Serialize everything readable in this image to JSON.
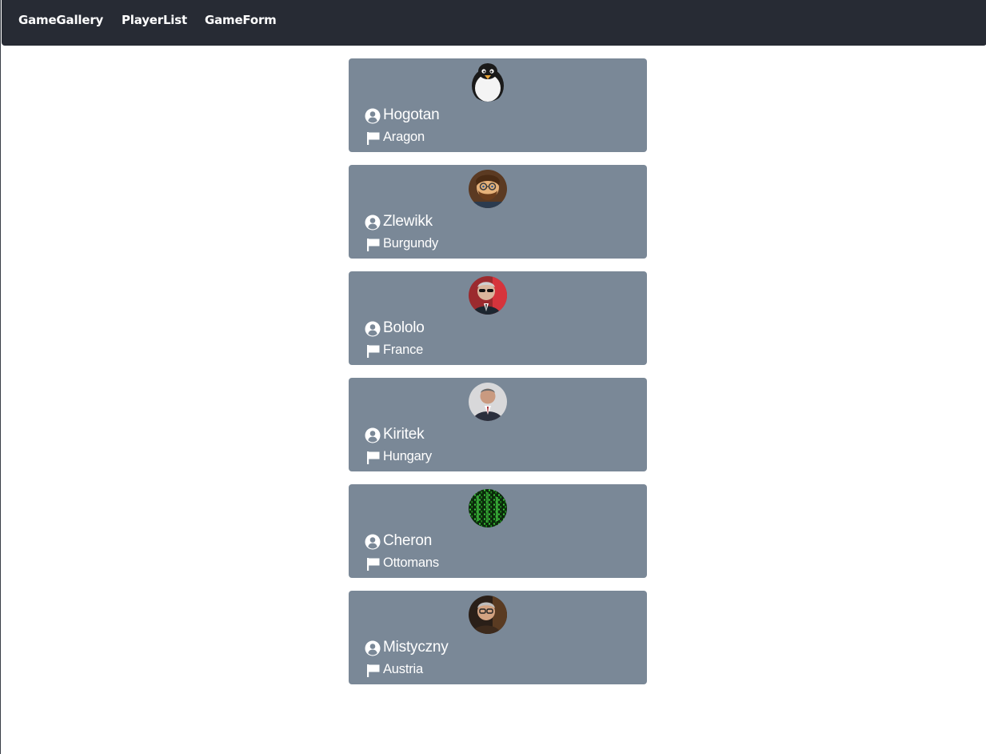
{
  "navbar": {
    "links": [
      {
        "label": "GameGallery"
      },
      {
        "label": "PlayerList"
      },
      {
        "label": "GameForm"
      }
    ],
    "background": "#272b34"
  },
  "theme": {
    "card_background": "#7a8897",
    "text_color": "#ffffff"
  },
  "players": [
    {
      "name": "Hogotan",
      "country": "Aragon",
      "avatar": "penguin-avatar",
      "user_icon": "user-circle-icon",
      "country_icon": "flag-icon"
    },
    {
      "name": "Zlewikk",
      "country": "Burgundy",
      "avatar": "bearded-cartoon-avatar",
      "user_icon": "user-circle-icon",
      "country_icon": "flag-icon"
    },
    {
      "name": "Bololo",
      "country": "France",
      "avatar": "sunglasses-man-avatar",
      "user_icon": "user-circle-icon",
      "country_icon": "flag-icon"
    },
    {
      "name": "Kiritek",
      "country": "Hungary",
      "avatar": "suited-man-avatar",
      "user_icon": "user-circle-icon",
      "country_icon": "flag-icon"
    },
    {
      "name": "Cheron",
      "country": "Ottomans",
      "avatar": "green-matrix-avatar",
      "user_icon": "user-circle-icon",
      "country_icon": "flag-icon"
    },
    {
      "name": "Mistyczny",
      "country": "Austria",
      "avatar": "glasses-man-avatar",
      "user_icon": "user-circle-icon",
      "country_icon": "flag-icon"
    }
  ]
}
